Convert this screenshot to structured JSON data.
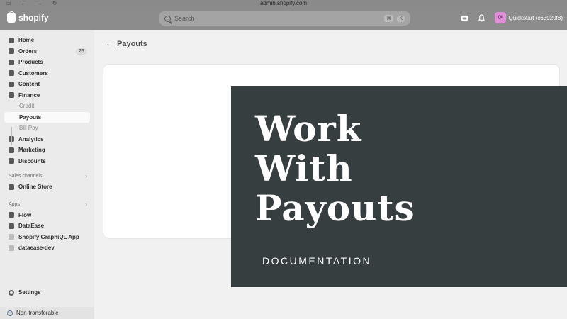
{
  "browser": {
    "url": "admin.shopify.com",
    "back_glyph": "←",
    "forward_glyph": "→",
    "reload_glyph": "↻",
    "sidebar_glyph": "▭"
  },
  "topbar": {
    "logo_text": "shopify",
    "search_placeholder": "Search",
    "shortcut_cmd": "⌘",
    "shortcut_key": "K",
    "avatar_initials": "QI",
    "store_name": "Quickstart (c63920f8)",
    "icons": [
      "store-icon",
      "bell-icon"
    ]
  },
  "sidebar": {
    "items": [
      {
        "label": "Home",
        "icon": "home-icon"
      },
      {
        "label": "Orders",
        "icon": "orders-icon",
        "badge": "23"
      },
      {
        "label": "Products",
        "icon": "tag-icon"
      },
      {
        "label": "Customers",
        "icon": "person-icon"
      },
      {
        "label": "Content",
        "icon": "content-icon"
      },
      {
        "label": "Finance",
        "icon": "bank-icon"
      }
    ],
    "finance_sub": [
      {
        "label": "Credit"
      },
      {
        "label": "Payouts",
        "active": true
      },
      {
        "label": "Bill Pay"
      }
    ],
    "items2": [
      {
        "label": "Analytics",
        "icon": "chart-icon"
      },
      {
        "label": "Marketing",
        "icon": "target-icon"
      },
      {
        "label": "Discounts",
        "icon": "discount-icon"
      }
    ],
    "sales_channels_label": "Sales channels",
    "sales_channels": [
      {
        "label": "Online Store",
        "icon": "store-icon"
      }
    ],
    "apps_label": "Apps",
    "apps": [
      {
        "label": "Flow",
        "icon": "flow-icon",
        "bold": true
      },
      {
        "label": "DataEase",
        "icon": "dataease-icon",
        "bold": true
      },
      {
        "label": "Shopify GraphiQL App",
        "icon": "app-icon",
        "bold": true
      },
      {
        "label": "dataease-dev",
        "icon": "app-icon",
        "bold": true
      }
    ],
    "settings_label": "Settings",
    "non_transferable_label": "Non-transferable"
  },
  "main": {
    "page_title": "Payouts"
  },
  "overlay": {
    "title_lines": [
      "Work",
      "With",
      "Payouts"
    ],
    "subtitle": "DOCUMENTATION"
  }
}
